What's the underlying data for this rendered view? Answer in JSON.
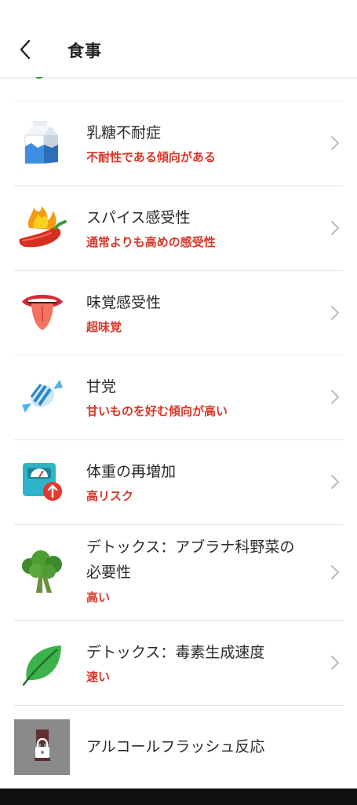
{
  "header": {
    "title": "食事",
    "back_icon": "chevron-left-icon"
  },
  "items": [
    {
      "id": "lactose",
      "icon": "milk-carton-icon",
      "title": "乳糖不耐症",
      "subtitle": "不耐性である傾向がある"
    },
    {
      "id": "spice",
      "icon": "chili-pepper-fire-icon",
      "title": "スパイス感受性",
      "subtitle": "通常よりも高めの感受性"
    },
    {
      "id": "taste",
      "icon": "tongue-icon",
      "title": "味覚感受性",
      "subtitle": "超味覚"
    },
    {
      "id": "sweet",
      "icon": "candy-icon",
      "title": "甘党",
      "subtitle": "甘いものを好む傾向が高い"
    },
    {
      "id": "weight",
      "icon": "scale-icon",
      "title": "体重の再増加",
      "subtitle": "高リスク"
    },
    {
      "id": "detox-veg",
      "icon": "broccoli-icon",
      "title_line1": "デトックス：アブラナ科野菜の",
      "title_line2": "必要性",
      "subtitle": "高い"
    },
    {
      "id": "detox-toxin",
      "icon": "leaf-icon",
      "title": "デトックス：毒素生成速度",
      "subtitle": "速い"
    },
    {
      "id": "alcohol",
      "icon": "locked-wine-icon",
      "title": "アルコールフラッシュ反応"
    }
  ],
  "colors": {
    "accent_red": "#d8372a",
    "divider": "#e4e4e4",
    "text": "#2a2a2a"
  }
}
